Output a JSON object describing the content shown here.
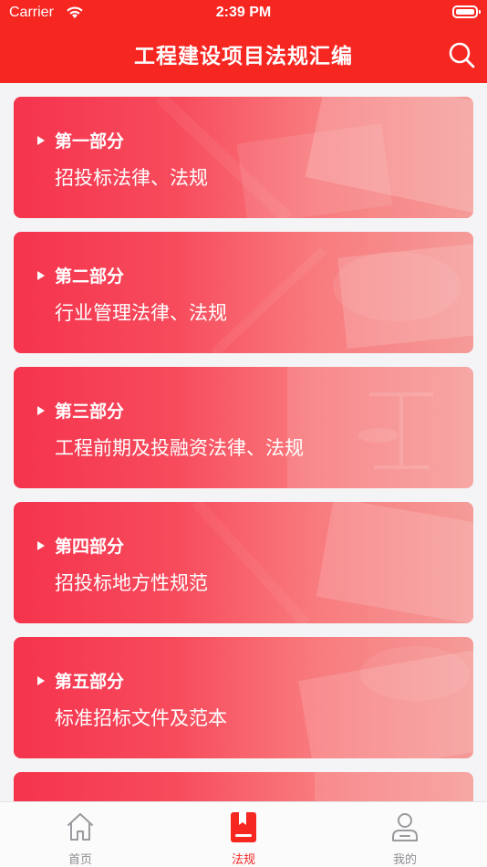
{
  "status_bar": {
    "carrier": "Carrier",
    "time": "2:39 PM"
  },
  "header": {
    "title": "工程建设项目法规汇编",
    "search_icon": "search-icon",
    "color": "#f62621"
  },
  "sections": [
    {
      "tag": "第一部分",
      "title": "招投标法律、法规"
    },
    {
      "tag": "第二部分",
      "title": "行业管理法律、法规"
    },
    {
      "tag": "第三部分",
      "title": "工程前期及投融资法律、法规"
    },
    {
      "tag": "第四部分",
      "title": "招投标地方性规范"
    },
    {
      "tag": "第五部分",
      "title": "标准招标文件及范本"
    },
    {
      "tag": "",
      "title": ""
    }
  ],
  "tabbar": {
    "items": [
      {
        "label": "首页",
        "icon": "home-icon",
        "active": false
      },
      {
        "label": "法规",
        "icon": "book-icon",
        "active": true
      },
      {
        "label": "我的",
        "icon": "user-icon",
        "active": false
      }
    ],
    "active_color": "#f62621",
    "inactive_color": "#8e8e93"
  }
}
